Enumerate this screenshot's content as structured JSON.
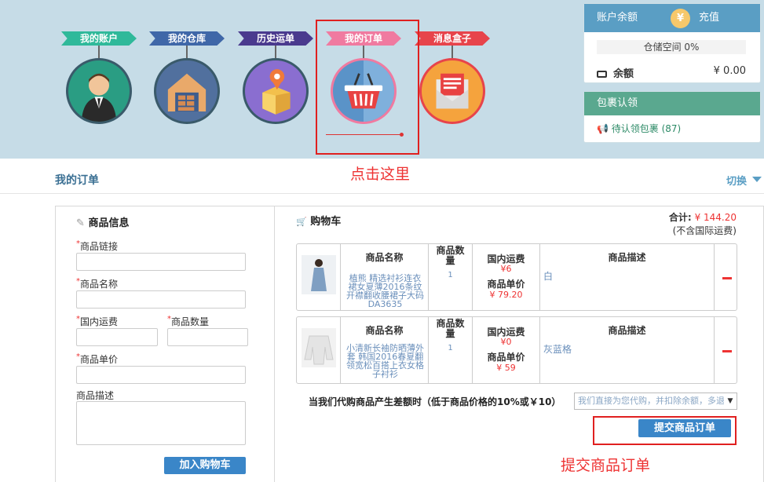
{
  "nav": {
    "items": [
      {
        "label": "我的账户",
        "color": "#2fb99a",
        "bg": "#2a9d83"
      },
      {
        "label": "我的仓库",
        "color": "#3f67a8",
        "bg": "#51709e"
      },
      {
        "label": "历史运单",
        "color": "#4a3a8e",
        "bg": "#8a6ed0"
      },
      {
        "label": "我的订单",
        "color": "#f07aa0",
        "bg": "#5a93c8"
      },
      {
        "label": "消息盒子",
        "color": "#e7444b",
        "bg": "#f5a33d"
      }
    ]
  },
  "annotations": {
    "click_here": "点击这里",
    "submit_order": "提交商品订单"
  },
  "account": {
    "title": "账户余额",
    "yen_symbol": "¥",
    "recharge": "充值",
    "storage": "仓储空间 0%",
    "storage_percent": 0,
    "balance_label": "余额",
    "balance_value": "¥ 0.00"
  },
  "package": {
    "title": "包裹认领",
    "link": "待认领包裹 (87)"
  },
  "page": {
    "title": "我的订单",
    "switch_label": "切换"
  },
  "form": {
    "title": "商品信息",
    "link_label": "商品链接",
    "name_label": "商品名称",
    "domestic_fee_label": "国内运费",
    "qty_label": "商品数量",
    "price_label": "商品单价",
    "desc_label": "商品描述",
    "add_button": "加入购物车"
  },
  "cart": {
    "title": "购物车",
    "total_label": "合计:",
    "total_value": "¥ 144.20",
    "total_note": "(不含国际运费)",
    "headers": {
      "name": "商品名称",
      "qty": "商品数量",
      "domestic_fee": "国内运费",
      "unit_price": "商品单价",
      "desc": "商品描述"
    },
    "items": [
      {
        "name": "植熊 精选衬衫连衣裙女夏薄2016条纹开襟翻收腰裙子大码 DA3635",
        "qty": "1",
        "fee": "¥6",
        "price": "¥ 79.20",
        "desc": "白"
      },
      {
        "name": "小清新长袖防晒薄外套 韩国2016春夏翻领宽松百搭上衣女格子衬衫",
        "qty": "1",
        "fee": "¥0",
        "price": "¥ 59",
        "desc": "灰蓝格"
      }
    ],
    "difference_label": "当我们代购商品产生差额时（低于商品价格的10%或￥10）",
    "difference_option": "我们直接为您代购，并扣除余额，多退少补",
    "submit_button": "提交商品订单"
  }
}
